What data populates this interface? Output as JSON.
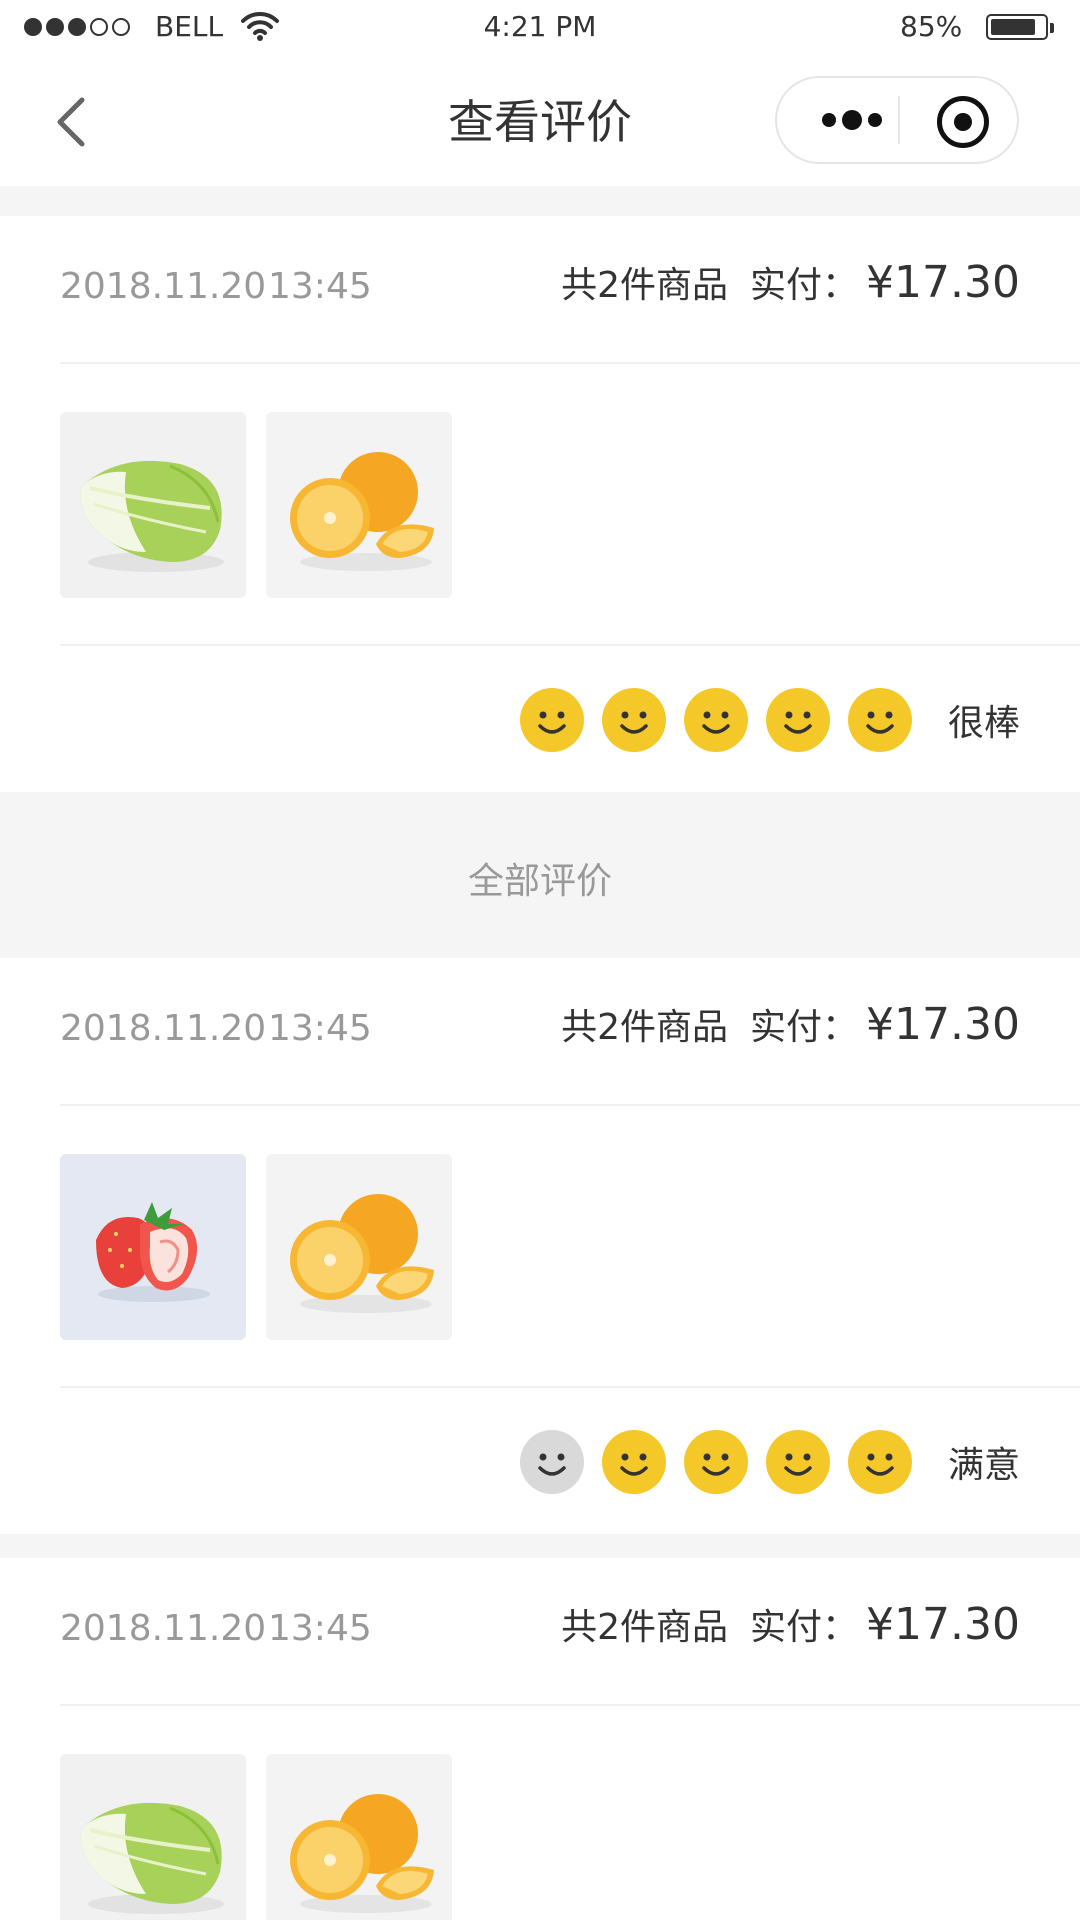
{
  "status_bar": {
    "signal_dots": [
      true,
      true,
      true,
      false,
      false
    ],
    "carrier": "BELL",
    "time": "4:21 PM",
    "battery_percent": "85%",
    "battery_level": 0.85
  },
  "nav": {
    "title": "查看评价",
    "back_icon": "chevron-left-icon",
    "more_icon": "more-dots-icon",
    "target_icon": "record-target-icon"
  },
  "colors": {
    "face_active": "#f5c82a",
    "face_inactive": "#d9d9d9",
    "text_main": "#333333",
    "text_muted": "#999999"
  },
  "cards": [
    {
      "date": "2018.11.20",
      "time": "13:45",
      "count_text": "共2件商品",
      "paid_label": "实付：",
      "price": "¥17.30",
      "images": [
        "cabbage",
        "orange"
      ],
      "rating": 5,
      "rating_text": "很棒"
    },
    {
      "date": "2018.11.20",
      "time": "13:45",
      "count_text": "共2件商品",
      "paid_label": "实付：",
      "price": "¥17.30",
      "images": [
        "strawberry",
        "orange"
      ],
      "rating": 4,
      "rating_text": "满意"
    },
    {
      "date": "2018.11.20",
      "time": "13:45",
      "count_text": "共2件商品",
      "paid_label": "实付：",
      "price": "¥17.30",
      "images": [
        "cabbage",
        "orange"
      ],
      "rating": null,
      "rating_text": ""
    }
  ],
  "divider": {
    "label": "全部评价"
  }
}
